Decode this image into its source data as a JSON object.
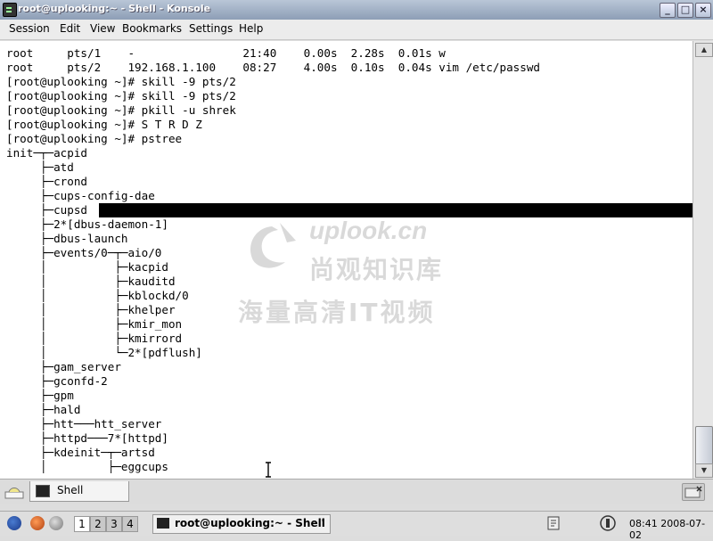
{
  "window": {
    "title": "root@uplooking:~ - Shell - Konsole"
  },
  "menu": [
    "Session",
    "Edit",
    "View",
    "Bookmarks",
    "Settings",
    "Help"
  ],
  "terminal_lines": [
    "root     pts/1    -                21:40    0.00s  2.28s  0.01s w",
    "root     pts/2    192.168.1.100    08:27    4.00s  0.10s  0.04s vim /etc/passwd",
    "[root@uplooking ~]# skill -9 pts/2",
    "[root@uplooking ~]# skill -9 pts/2",
    "[root@uplooking ~]# pkill -u shrek",
    "[root@uplooking ~]# S T R D Z",
    "[root@uplooking ~]# pstree",
    "init─┬─acpid",
    "     ├─atd",
    "     ├─crond",
    "     ├─cups-config-dae",
    "     ├─cupsd",
    "     ├─2*[dbus-daemon-1]",
    "     ├─dbus-launch",
    "     ├─events/0─┬─aio/0",
    "     │          ├─kacpid",
    "     │          ├─kauditd",
    "     │          ├─kblockd/0",
    "     │          ├─khelper",
    "     │          ├─kmir_mon",
    "     │          ├─kmirrord",
    "     │          └─2*[pdflush]",
    "     ├─gam_server",
    "     ├─gconfd-2",
    "     ├─gpm",
    "     ├─hald",
    "     ├─htt───htt_server",
    "     ├─httpd───7*[httpd]",
    "     ├─kdeinit─┬─artsd",
    "     │         ├─eggcups"
  ],
  "watermark": {
    "brand": "uplook.cn",
    "line1": "尚观知识库",
    "line2": "海量高清IT视频"
  },
  "tabs": {
    "active": "Shell"
  },
  "taskbar": {
    "workspaces": [
      "1",
      "2",
      "3",
      "4"
    ],
    "window_label": "root@uplooking:~ - Shell",
    "clock": "08:41  2008-07-02"
  },
  "colors": {
    "titlebar": "#8d9eb6",
    "terminal_bg": "#ffffff",
    "terminal_fg": "#000000"
  }
}
